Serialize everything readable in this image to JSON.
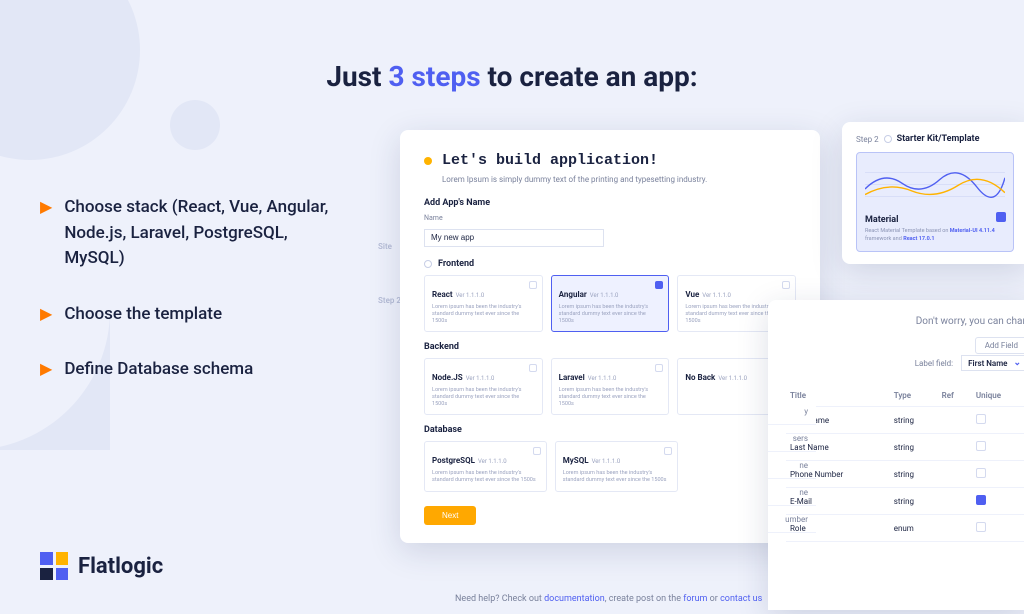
{
  "headline": {
    "pre": "Just ",
    "em": "3 steps",
    "post": " to create an app:"
  },
  "bullets": [
    "Choose stack (React, Vue, Angular, Node.js, Laravel, PostgreSQL, MySQL)",
    "Choose the template",
    "Define Database schema"
  ],
  "logo_text": "Flatlogic",
  "sidebar_link": "Site",
  "wizard": {
    "title": "Let's build application!",
    "sub": "Lorem Ipsum is simply dummy text of the printing and typesetting industry.",
    "name_section": "Add App's Name",
    "name_label": "Name",
    "name_value": "My new app",
    "step2_num": "Step 2",
    "step2_title": "Frontend",
    "frontend": [
      {
        "name": "React",
        "ver": "Ver 1.1.1.0",
        "desc": "Lorem ipsum has been the industry's standard dummy text ever since the 1500s",
        "selected": false
      },
      {
        "name": "Angular",
        "ver": "Ver 1.1.1.0",
        "desc": "Lorem ipsum has been the industry's standard dummy text ever since the 1500s",
        "selected": true
      },
      {
        "name": "Vue",
        "ver": "Ver 1.1.1.0",
        "desc": "Lorem ipsum has been the industry's standard dummy text ever since the 1500s",
        "selected": false
      }
    ],
    "backend_label": "Backend",
    "backend": [
      {
        "name": "Node.JS",
        "ver": "Ver 1.1.1.0",
        "desc": "Lorem ipsum has been the industry's standard dummy text ever since the 1500s"
      },
      {
        "name": "Laravel",
        "ver": "Ver 1.1.1.0",
        "desc": "Lorem ipsum has been the industry's standard dummy text ever since the 1500s"
      },
      {
        "name": "No Back",
        "ver": "Ver 1.1.1.0",
        "desc": ""
      }
    ],
    "database_label": "Database",
    "database": [
      {
        "name": "PostgreSQL",
        "ver": "Ver 1.1.1.0",
        "desc": "Lorem ipsum has been the industry's standard dummy text ever since the 1500s"
      },
      {
        "name": "MySQL",
        "ver": "Ver 1.1.1.0",
        "desc": "Lorem ipsum has been the industry's standard dummy text ever since the 1500s"
      }
    ],
    "next": "Next"
  },
  "template": {
    "step_num": "Step 2",
    "step_title": "Starter Kit/Template",
    "name": "Material",
    "desc_pre": "React Material Template based on ",
    "desc_b1": "Material-UI 4.11.4",
    "desc_mid": " framework and ",
    "desc_b2": "React 17.0.1"
  },
  "schema": {
    "hint": "Don't worry, you can chan",
    "add_field": "Add Field",
    "label_field_label": "Label field:",
    "label_field_value": "First Name",
    "left_col": [
      "y",
      "sers",
      "ne",
      "ne",
      "umber",
      "",
      ""
    ],
    "cols": [
      "Title",
      "Type",
      "Ref",
      "Unique"
    ],
    "rows": [
      {
        "title": "First Name",
        "type": "string",
        "unique": false
      },
      {
        "title": "Last Name",
        "type": "string",
        "unique": false
      },
      {
        "title": "Phone Number",
        "type": "string",
        "unique": false
      },
      {
        "title": "E-Mail",
        "type": "string",
        "unique": true
      },
      {
        "title": "Role",
        "type": "enum",
        "unique": false
      }
    ]
  },
  "help": {
    "pre": "Need help? Check out ",
    "l1": "documentation",
    "mid1": ", create post on the ",
    "l2": "forum",
    "mid2": " or ",
    "l3": "contact us"
  }
}
